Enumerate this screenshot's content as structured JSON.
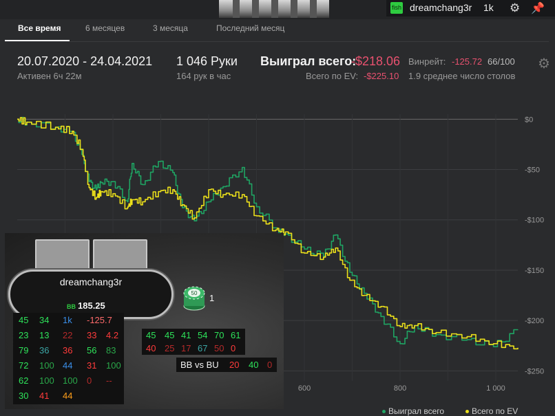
{
  "top": {
    "badge": "fish",
    "username": "dreamchang3r",
    "hands_short": "1k",
    "gear_icon": "gear-icon",
    "pin_icon": "pin-icon"
  },
  "tabs": [
    {
      "label": "Все время",
      "active": true
    },
    {
      "label": "6 месяцев",
      "active": false
    },
    {
      "label": "3 месяца",
      "active": false
    },
    {
      "label": "Последний месяц",
      "active": false
    }
  ],
  "stats": {
    "date_range": "20.07.2020 - 24.04.2021",
    "active": "Активен 6ч 22м",
    "hands": "1 046 Руки",
    "hands_per_hour": "164 рук в час",
    "won_label": "Выиграл всего:",
    "won_value": "-$218.06",
    "ev_label": "Всего по EV:",
    "ev_value": "-$225.10",
    "winrate_label": "Винрейт:",
    "winrate_value": "-125.72",
    "winrate_ratio": "66/100",
    "tables": "1.9 среднее число столов"
  },
  "chart_data": {
    "type": "line",
    "ylim": [
      -260,
      5
    ],
    "xlim": [
      0,
      1046
    ],
    "y_ticks": [
      0,
      -50,
      -100,
      -150,
      -200,
      -250
    ],
    "y_tick_labels": [
      "$0",
      "-$50",
      "-$100",
      "-$150",
      "-$200",
      "-$250"
    ],
    "x_ticks": [
      600,
      800,
      1000
    ],
    "x_tick_labels": [
      "600",
      "800",
      "1 000"
    ],
    "grid": true,
    "legend_position": "bottom-right",
    "series": [
      {
        "name": "Выиграл всего",
        "color": "#1fa463",
        "x": [
          0,
          20,
          80,
          115,
          135,
          150,
          165,
          175,
          200,
          230,
          240,
          262,
          295,
          325,
          345,
          370,
          400,
          430,
          470,
          500,
          540,
          560,
          600,
          640,
          665,
          695,
          725,
          760,
          800,
          830,
          875,
          940,
          995,
          1046
        ],
        "y": [
          0,
          -3,
          -8,
          -12,
          -35,
          -62,
          -70,
          -63,
          -62,
          -82,
          -44,
          -65,
          -42,
          -53,
          -88,
          -101,
          -82,
          -67,
          -48,
          -87,
          -108,
          -114,
          -129,
          -136,
          -115,
          -152,
          -173,
          -196,
          -223,
          -205,
          -214,
          -219,
          -226,
          -209
        ]
      },
      {
        "name": "Всего по EV",
        "color": "#ece01a",
        "x": [
          0,
          20,
          80,
          115,
          135,
          150,
          165,
          175,
          200,
          230,
          240,
          262,
          295,
          325,
          345,
          370,
          400,
          430,
          470,
          500,
          540,
          560,
          600,
          640,
          665,
          695,
          725,
          760,
          800,
          830,
          875,
          940,
          995,
          1046
        ],
        "y": [
          0,
          -3,
          -8,
          -12,
          -30,
          -68,
          -78,
          -72,
          -74,
          -88,
          -80,
          -82,
          -72,
          -70,
          -85,
          -98,
          -70,
          -75,
          -75,
          -96,
          -110,
          -112,
          -133,
          -137,
          -128,
          -160,
          -175,
          -186,
          -206,
          -205,
          -212,
          -216,
          -223,
          -227
        ]
      }
    ]
  },
  "hud": {
    "player": "dreamchang3r",
    "bb_label": "BB",
    "bb_value": "185.25",
    "chip_label": "50",
    "chip_count": "1",
    "grid_rows": [
      [
        {
          "v": "45",
          "c": "green"
        },
        {
          "v": "34",
          "c": "green"
        },
        {
          "v": "1k",
          "c": "blue"
        },
        {
          "v": "-125.7",
          "c": "pink"
        }
      ],
      [
        {
          "v": "23",
          "c": "green"
        },
        {
          "v": "13",
          "c": "green"
        },
        {
          "v": "22",
          "c": "dred"
        },
        {
          "v": "33",
          "c": "red"
        },
        {
          "v": "4.2",
          "c": "red"
        }
      ],
      [
        {
          "v": "79",
          "c": "green"
        },
        {
          "v": "36",
          "c": "teal"
        },
        {
          "v": "36",
          "c": "red"
        },
        {
          "v": "56",
          "c": "green"
        },
        {
          "v": "83",
          "c": "dgreen"
        }
      ],
      [
        {
          "v": "72",
          "c": "green"
        },
        {
          "v": "100",
          "c": "dgreen"
        },
        {
          "v": "44",
          "c": "blue"
        },
        {
          "v": "31",
          "c": "red"
        },
        {
          "v": "100",
          "c": "dgreen"
        }
      ],
      [
        {
          "v": "62",
          "c": "green"
        },
        {
          "v": "100",
          "c": "dgreen"
        },
        {
          "v": "100",
          "c": "dgreen"
        },
        {
          "v": "0",
          "c": "dred"
        },
        {
          "v": "--",
          "c": "dred"
        }
      ],
      [
        {
          "v": "30",
          "c": "green"
        },
        {
          "v": "41",
          "c": "red"
        },
        {
          "v": "44",
          "c": "orange"
        }
      ]
    ],
    "box2_rows": [
      [
        {
          "v": "45",
          "c": "green"
        },
        {
          "v": "45",
          "c": "green"
        },
        {
          "v": "41",
          "c": "green"
        },
        {
          "v": "54",
          "c": "green"
        },
        {
          "v": "70",
          "c": "green"
        },
        {
          "v": "61",
          "c": "green"
        }
      ],
      [
        {
          "v": "40",
          "c": "red"
        },
        {
          "v": "25",
          "c": "dred"
        },
        {
          "v": "17",
          "c": "dred"
        },
        {
          "v": "67",
          "c": "teal"
        },
        {
          "v": "50",
          "c": "dred"
        },
        {
          "v": "0",
          "c": "red"
        }
      ]
    ],
    "bbvsbu_label": "BB vs BU",
    "bbvsbu_values": [
      {
        "v": "20",
        "c": "red"
      },
      {
        "v": "40",
        "c": "green"
      },
      {
        "v": "0",
        "c": "dred"
      }
    ]
  },
  "legend": {
    "won": "Выиграл всего",
    "ev": "Всего по EV"
  }
}
